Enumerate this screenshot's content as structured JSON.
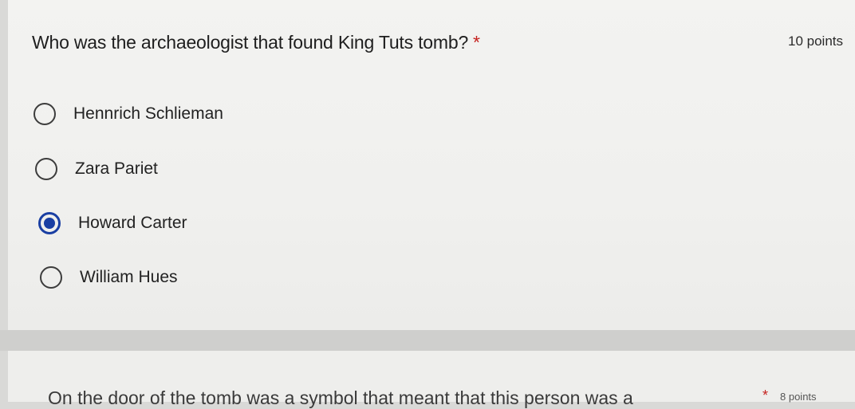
{
  "question1": {
    "title": "Who was the archaeologist that found King Tuts tomb?",
    "required_mark": "*",
    "points": "10 points",
    "options": [
      {
        "label": "Hennrich Schlieman",
        "selected": false
      },
      {
        "label": "Zara Pariet",
        "selected": false
      },
      {
        "label": "Howard Carter",
        "selected": true
      },
      {
        "label": "William Hues",
        "selected": false
      }
    ]
  },
  "question2": {
    "title": "On the door of the tomb was a symbol that meant that this person was a",
    "required_mark": "*",
    "points": "8 points"
  },
  "colors": {
    "accent": "#1a3fa3",
    "required": "#c5221f"
  }
}
